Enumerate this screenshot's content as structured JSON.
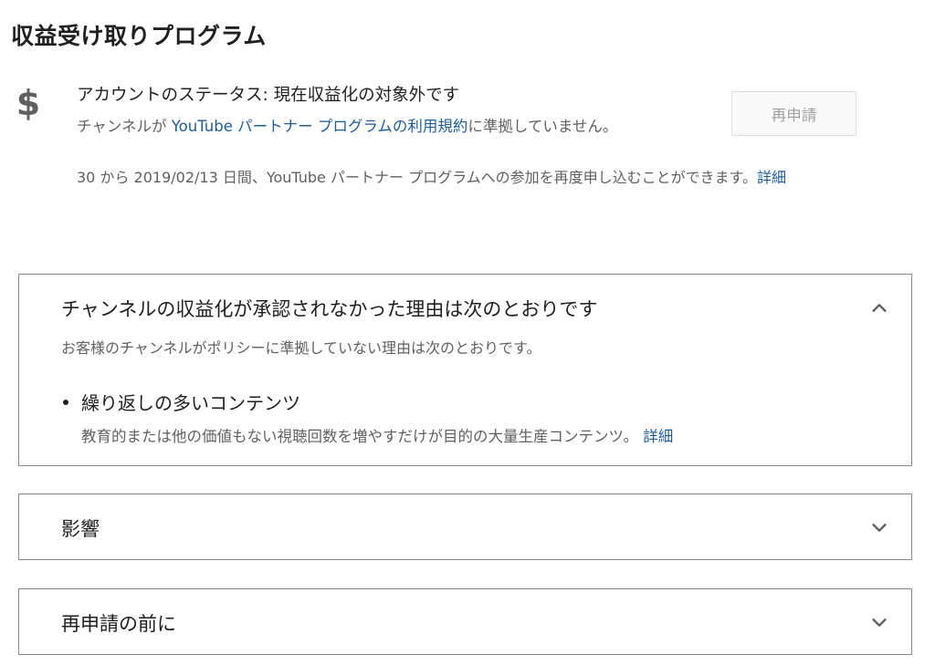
{
  "page": {
    "title": "収益受け取りプログラム"
  },
  "status": {
    "icon": "dollar-sign-icon",
    "label": "アカウントのステータス:",
    "value": "現在収益化の対象外です",
    "desc_prefix": "チャンネルが ",
    "desc_link": "YouTube パートナー プログラムの利用規約",
    "desc_suffix": "に準拠していません。",
    "reapply_button": "再申請",
    "reapply_info": "30 から 2019/02/13 日間、YouTube パートナー プログラムへの参加を再度申し込むことができます。",
    "reapply_info_link": "詳細"
  },
  "panels": {
    "reasons": {
      "title": "チャンネルの収益化が承認されなかった理由は次のとおりです",
      "subtitle": "お客様のチャンネルがポリシーに準拠していない理由は次のとおりです。",
      "items": [
        {
          "title": "繰り返しの多いコンテンツ",
          "desc": "教育的または他の価値もない視聴回数を増やすだけが目的の大量生産コンテンツ。",
          "link": "詳細"
        }
      ],
      "icon": "chevron-up-icon"
    },
    "impact": {
      "title": "影響",
      "icon": "chevron-down-icon"
    },
    "before_reapply": {
      "title": "再申請の前に",
      "icon": "chevron-down-icon"
    }
  },
  "colors": {
    "link": "#1a5d9c",
    "secondary_text": "#606060",
    "border": "#8a8a8a",
    "button_bg": "#f9f9f9"
  }
}
